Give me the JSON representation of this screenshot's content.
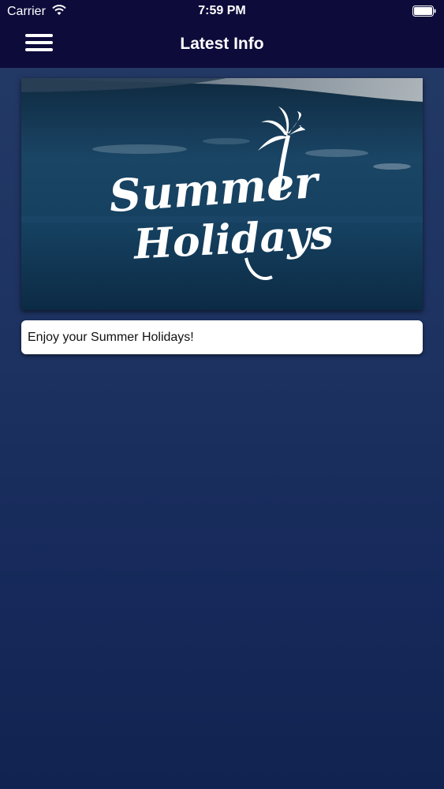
{
  "status_bar": {
    "carrier": "Carrier",
    "time": "7:59 PM",
    "wifi_icon": "wifi-icon",
    "battery_icon": "battery-icon"
  },
  "nav": {
    "title": "Latest Info",
    "menu_icon": "hamburger-menu-icon"
  },
  "feed": {
    "items": [
      {
        "image_text_line1": "Summer",
        "image_text_line2": "Holidays",
        "image_icon": "palm-tree-icon",
        "caption": "Enjoy your Summer Holidays!"
      }
    ]
  },
  "colors": {
    "nav_background": "#0d0b3a",
    "page_background_top": "#243a66",
    "page_background_bottom": "#112350",
    "caption_background": "#ffffff"
  }
}
